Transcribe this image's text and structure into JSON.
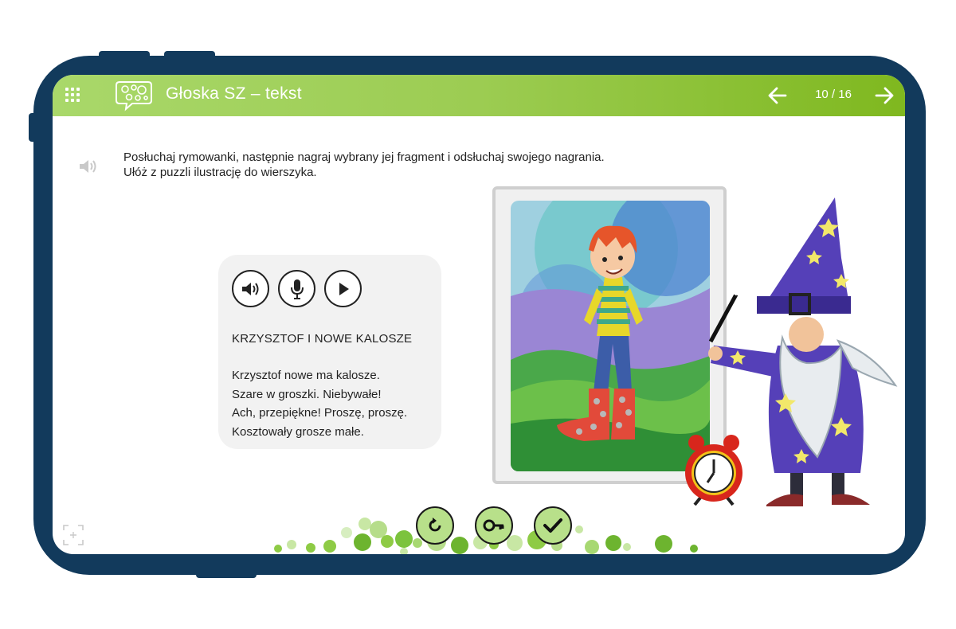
{
  "header": {
    "title": "Głoska SZ – tekst",
    "page_counter": "10 / 16",
    "icons": {
      "menu": "grid-menu-icon",
      "logo": "speech-bubble-icon",
      "prev": "arrow-left-icon",
      "next": "arrow-right-icon"
    }
  },
  "instructions": {
    "line1": "Posłuchaj rymowanki, następnie nagraj wybrany jej fragment i odsłuchaj swojego nagrania.",
    "line2": "Ułóż z puzzli ilustrację do wierszyka."
  },
  "poem": {
    "title": "KRZYSZTOF I NOWE KALOSZE",
    "lines": [
      "Krzysztof nowe ma kalosze.",
      "Szare w groszki. Niebywałe!",
      "Ach, przepiękne! Proszę, proszę.",
      "Kosztowały grosze małe."
    ],
    "controls": [
      "speaker-icon",
      "microphone-icon",
      "play-icon"
    ]
  },
  "bottom_controls": [
    "reset-icon",
    "key-icon",
    "check-icon"
  ],
  "colors": {
    "header_start": "#a9d86a",
    "header_end": "#7fb81f",
    "tablet_frame": "#123a5c",
    "button_fill": "#b8e08a"
  }
}
